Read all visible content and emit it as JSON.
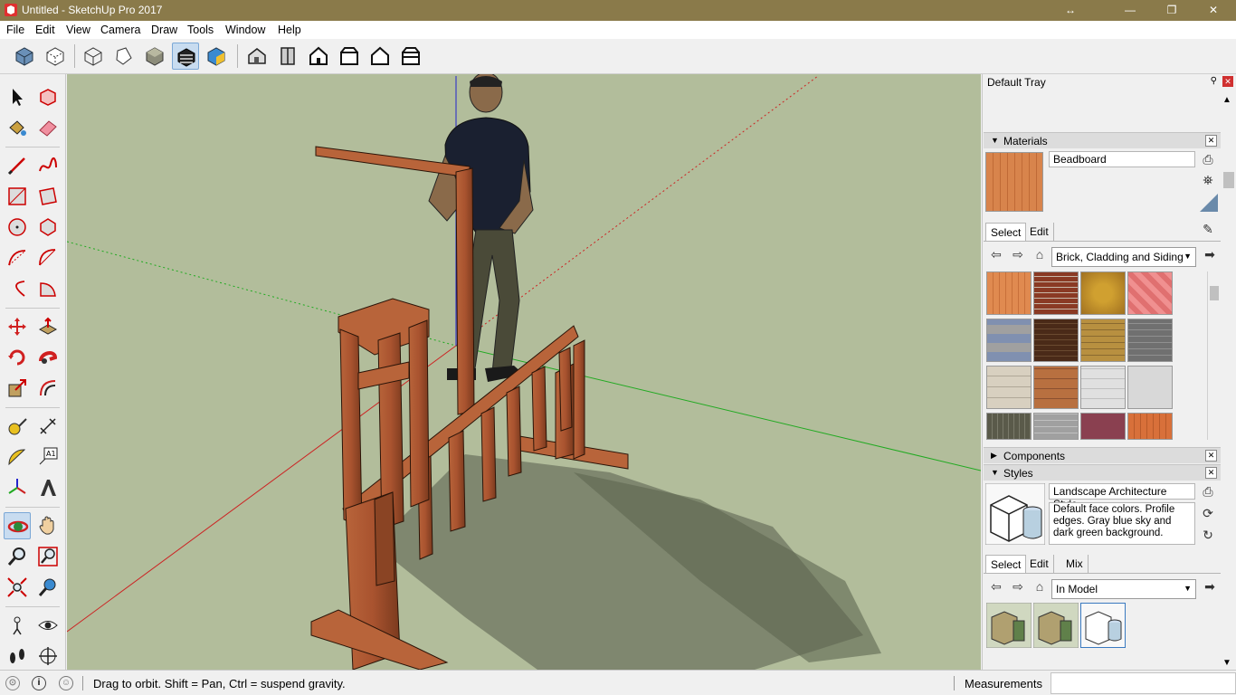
{
  "window": {
    "title": "Untitled - SketchUp Pro 2017",
    "restore_glyph": "↔",
    "minimize_glyph": "—",
    "maximize_glyph": "❐",
    "close_glyph": "✕"
  },
  "menu": {
    "items": [
      "File",
      "Edit",
      "View",
      "Camera",
      "Draw",
      "Tools",
      "Window",
      "Help"
    ]
  },
  "toolbar": {
    "icons": [
      "xray-icon",
      "back-edges-icon",
      "wireframe-icon",
      "hidden-line-icon",
      "shaded-icon",
      "shaded-textures-icon",
      "monochrome-icon",
      "iso-view-icon",
      "top-view-icon",
      "front-view-icon",
      "right-view-icon",
      "back-view-icon",
      "left-view-icon"
    ],
    "active_icon": "shaded-textures-icon"
  },
  "tools": {
    "active": "orbit-icon"
  },
  "tray": {
    "title": "Default Tray",
    "pin_glyph": "📌",
    "close_glyph": "✕",
    "materials": {
      "header": "Materials",
      "name": "Beadboard",
      "tabs": [
        "Select",
        "Edit"
      ],
      "collection": "Brick, Cladding and Siding"
    },
    "components": {
      "header": "Components"
    },
    "styles": {
      "header": "Styles",
      "name": "Landscape Architecture Style",
      "description": "Default face colors. Profile edges. Gray blue sky and dark green background.",
      "tabs": [
        "Select",
        "Edit",
        "Mix"
      ],
      "collection": "In Model"
    }
  },
  "status": {
    "hint": "Drag to orbit. Shift = Pan, Ctrl = suspend gravity.",
    "measurements_label": "Measurements",
    "measurements_value": ""
  },
  "colors": {
    "title_bar": "#8a7a4a",
    "sky_ground": "#b2bd9b",
    "wood": "#a9532f",
    "red_axis": "#cc2222",
    "green_axis": "#22aa22",
    "blue_axis": "#2222cc"
  }
}
